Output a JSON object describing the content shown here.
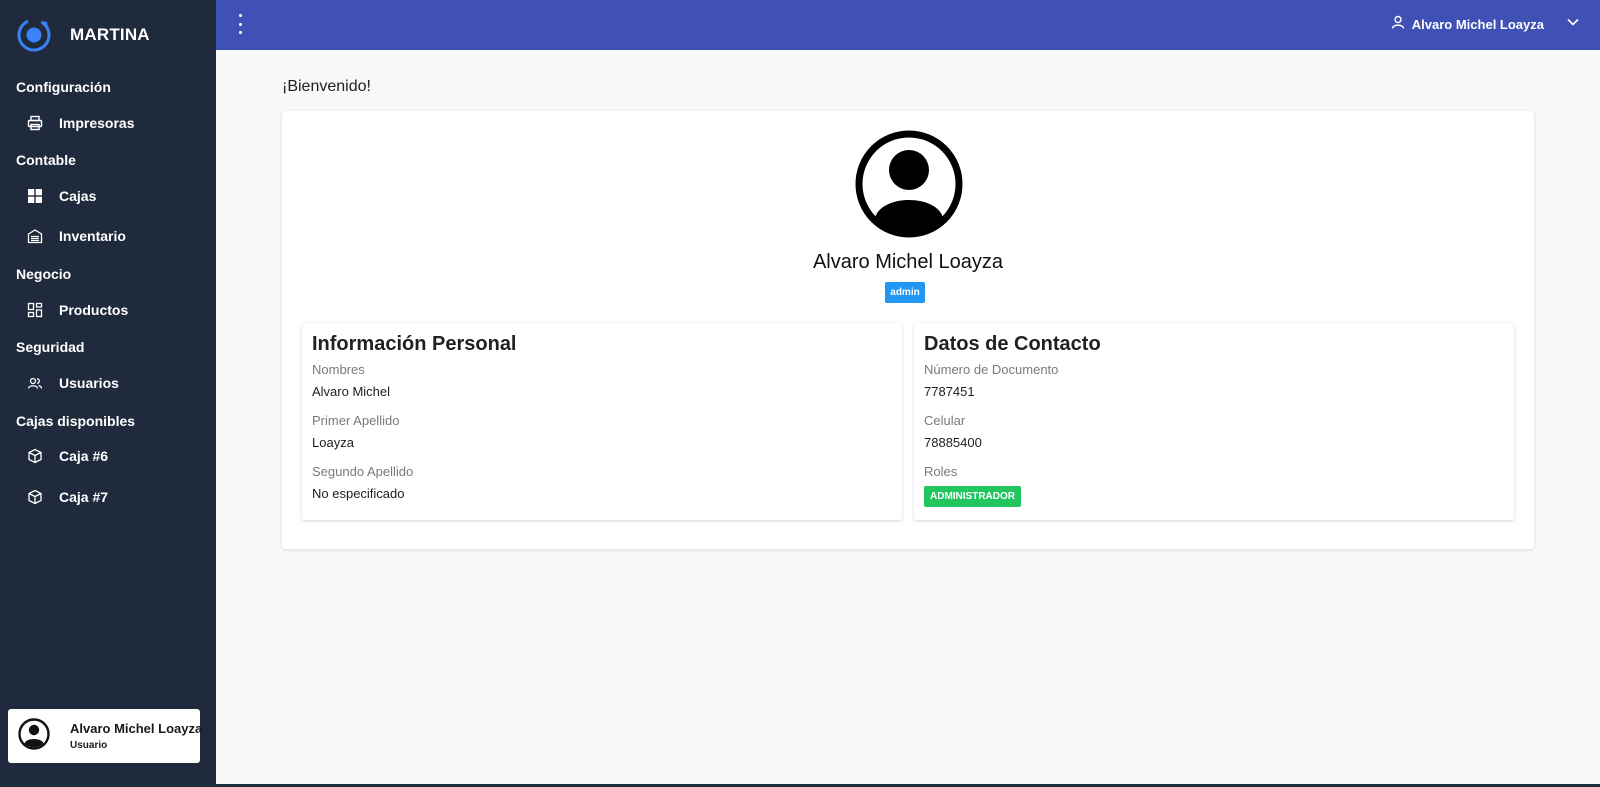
{
  "brand": {
    "title": "MARTINA",
    "accent_color": "#3b82f6"
  },
  "sidebar": {
    "sections": [
      {
        "title": "Configuración",
        "items": [
          {
            "label": "Impresoras",
            "icon": "printer-icon"
          }
        ]
      },
      {
        "title": "Contable",
        "items": [
          {
            "label": "Cajas",
            "icon": "grid-icon"
          },
          {
            "label": "Inventario",
            "icon": "warehouse-icon"
          }
        ]
      },
      {
        "title": "Negocio",
        "items": [
          {
            "label": "Productos",
            "icon": "dashboard-icon"
          }
        ]
      },
      {
        "title": "Seguridad",
        "items": [
          {
            "label": "Usuarios",
            "icon": "users-icon"
          }
        ]
      },
      {
        "title": "Cajas disponibles",
        "items": [
          {
            "label": "Caja #6",
            "icon": "box-icon"
          },
          {
            "label": "Caja #7",
            "icon": "box-icon"
          }
        ]
      }
    ],
    "user": {
      "name": "Alvaro Michel Loayza",
      "role": "Usuario"
    },
    "background": "#1f2a3c"
  },
  "topbar": {
    "user_name": "Alvaro Michel Loayza",
    "background": "#3f51b5"
  },
  "main": {
    "welcome": "¡Bienvenido!",
    "profile": {
      "name": "Alvaro Michel Loayza",
      "badge": "admin"
    },
    "personal": {
      "title": "Información Personal",
      "fields": [
        {
          "label": "Nombres",
          "value": "Alvaro Michel"
        },
        {
          "label": "Primer Apellido",
          "value": "Loayza"
        },
        {
          "label": "Segundo Apellido",
          "value": "No especificado"
        }
      ]
    },
    "contact": {
      "title": "Datos de Contacto",
      "fields": [
        {
          "label": "Número de Documento",
          "value": "7787451"
        },
        {
          "label": "Celular",
          "value": "78885400"
        }
      ],
      "roles_label": "Roles",
      "roles_value": "ADMINISTRADOR"
    }
  }
}
